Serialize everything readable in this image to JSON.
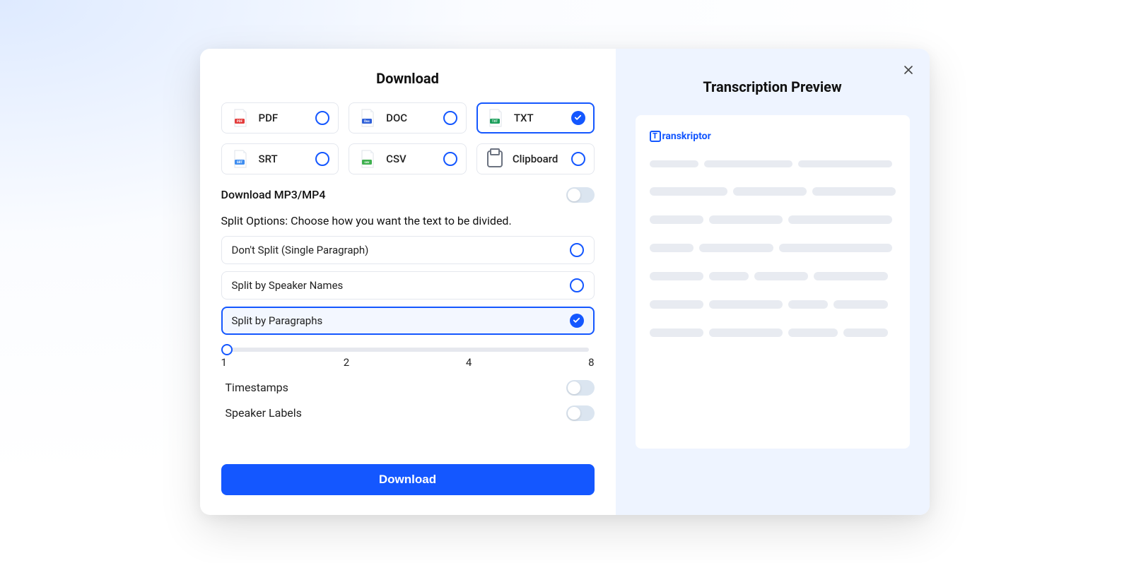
{
  "modal": {
    "title": "Download",
    "formats": [
      {
        "id": "pdf",
        "label": "PDF",
        "badge": "PDF",
        "badge_bg": "#e33c3c",
        "selected": false
      },
      {
        "id": "doc",
        "label": "DOC",
        "badge": "Doc",
        "badge_bg": "#2e5fd8",
        "selected": false
      },
      {
        "id": "txt",
        "label": "TXT",
        "badge": "TXT",
        "badge_bg": "#1a9e5a",
        "selected": true
      },
      {
        "id": "srt",
        "label": "SRT",
        "badge": "SRT",
        "badge_bg": "#3e8df0",
        "selected": false
      },
      {
        "id": "csv",
        "label": "CSV",
        "badge": "csv",
        "badge_bg": "#3fb04f",
        "selected": false
      },
      {
        "id": "clipboard",
        "label": "Clipboard",
        "is_clipboard": true,
        "selected": false
      }
    ],
    "download_media": {
      "label": "Download MP3/MP4",
      "enabled": false
    },
    "split_section_label": "Split Options: Choose how you want the text to be divided.",
    "split_options": [
      {
        "id": "none",
        "label": "Don't Split (Single Paragraph)",
        "selected": false
      },
      {
        "id": "speaker",
        "label": "Split by Speaker Names",
        "selected": false
      },
      {
        "id": "paragraph",
        "label": "Split by Paragraphs",
        "selected": true
      }
    ],
    "slider": {
      "min": 1,
      "max": 8,
      "value": 1,
      "marks": [
        "1",
        "2",
        "4",
        "8"
      ]
    },
    "settings": {
      "timestamps": {
        "label": "Timestamps",
        "enabled": false
      },
      "speaker_labels": {
        "label": "Speaker Labels",
        "enabled": false
      }
    },
    "action_button": "Download"
  },
  "preview": {
    "title": "Transcription Preview",
    "brand": "ranskriptor",
    "brand_initial": "T"
  }
}
